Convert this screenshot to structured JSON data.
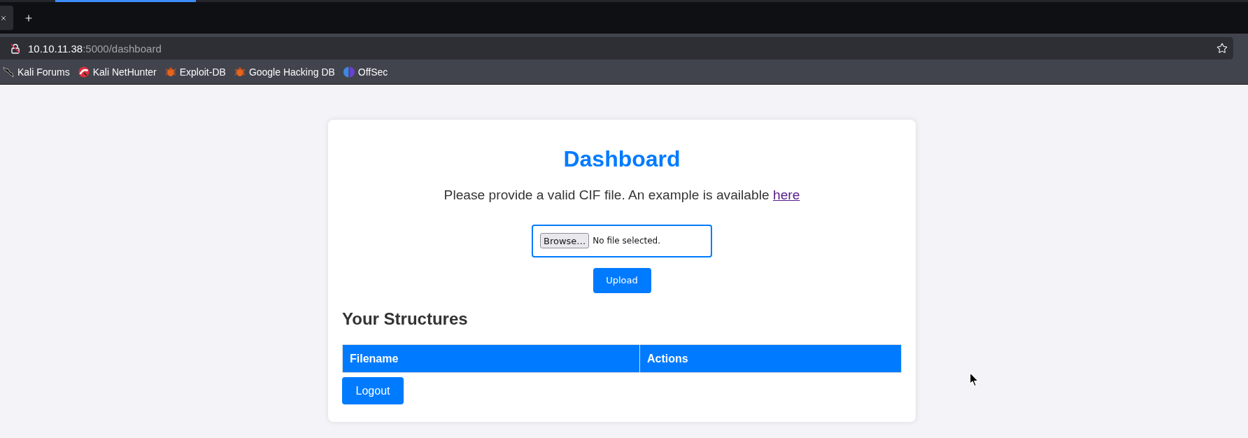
{
  "browser": {
    "address": {
      "host": "10.10.11.38",
      "path": ":5000/dashboard"
    },
    "bookmarks": [
      {
        "label": "Kali Forums",
        "kind": "dragon"
      },
      {
        "label": "Kali NetHunter",
        "kind": "swoosh"
      },
      {
        "label": "Exploit-DB",
        "kind": "bug"
      },
      {
        "label": "Google Hacking DB",
        "kind": "bug"
      },
      {
        "label": "OffSec",
        "kind": "split"
      }
    ]
  },
  "page": {
    "title": "Dashboard",
    "intro": "Please provide a valid CIF file. An example is available",
    "link": "here",
    "file_input": {
      "button": "Browse…",
      "status": "No file selected."
    },
    "upload_button": "Upload",
    "section_title": "Your Structures",
    "table": {
      "columns": [
        "Filename",
        "Actions"
      ]
    },
    "logout_button": "Logout"
  }
}
